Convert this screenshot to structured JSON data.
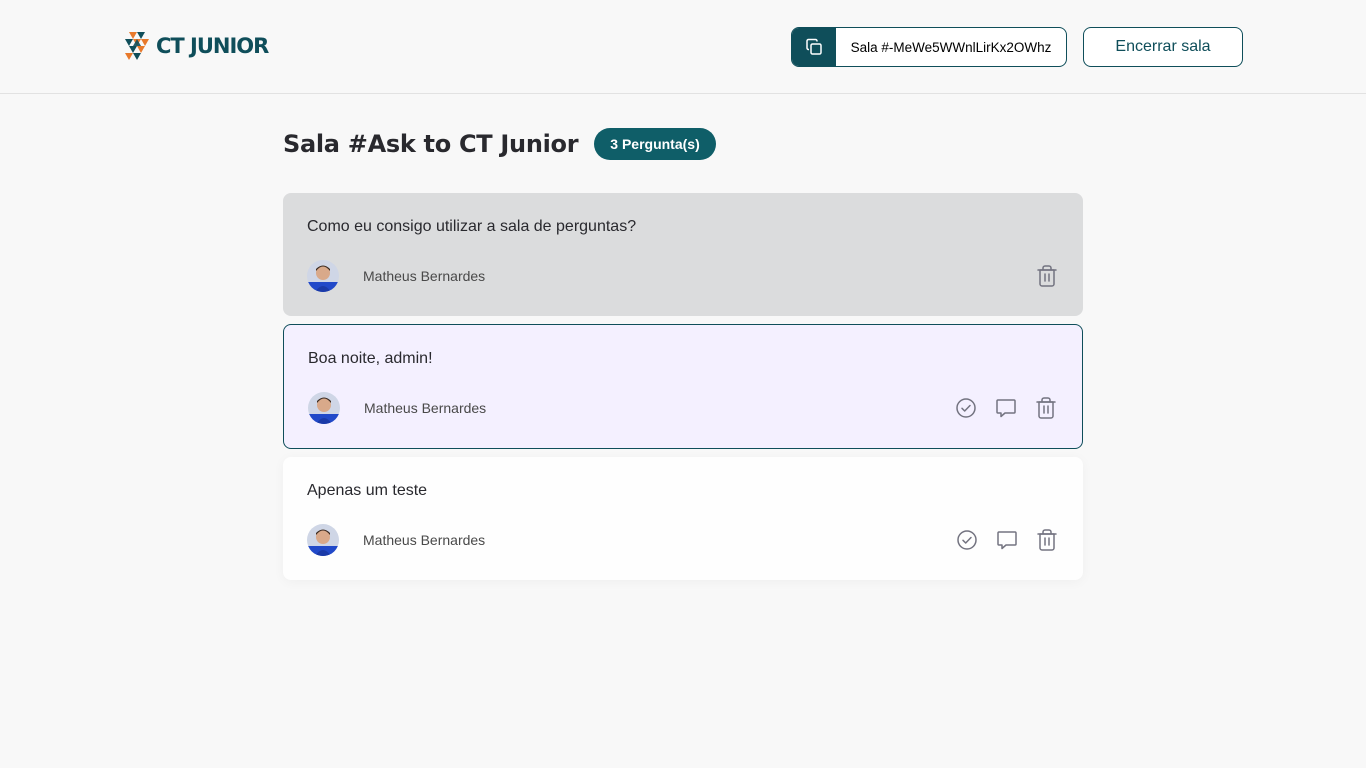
{
  "header": {
    "logo_text": "CT JUNIOR",
    "room_code_label": "Sala #-MeWe5WWnlLirKx2OWhz",
    "close_room_label": "Encerrar sala"
  },
  "room": {
    "title": "Sala #Ask to CT Junior",
    "question_count_label": "3 Pergunta(s)"
  },
  "questions": [
    {
      "content": "Como eu consigo utilizar a sala de perguntas?",
      "author": "Matheus Bernardes",
      "state": "answered",
      "actions": [
        "trash-icon"
      ]
    },
    {
      "content": "Boa noite, admin!",
      "author": "Matheus Bernardes",
      "state": "highlighted",
      "actions": [
        "check-circle-icon",
        "answer-bubble-icon",
        "trash-icon"
      ]
    },
    {
      "content": "Apenas um teste",
      "author": "Matheus Bernardes",
      "state": "normal",
      "actions": [
        "check-circle-icon",
        "answer-bubble-icon",
        "trash-icon"
      ]
    }
  ],
  "colors": {
    "brand": "#0f4e5a",
    "badge": "#0f5e68",
    "answered_bg": "#dbdcdd",
    "highlighted_bg": "#f4f0ff",
    "page_bg": "#f8f8f8"
  }
}
